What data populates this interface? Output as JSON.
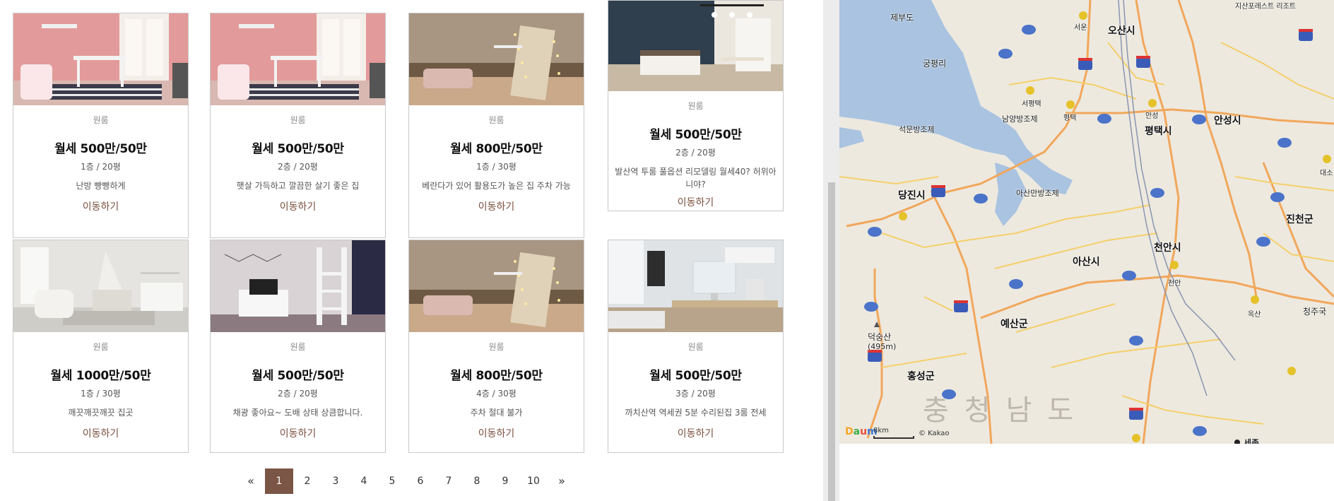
{
  "listings": [
    {
      "type": "원룸",
      "price": "월세 500만/50만",
      "floor": "1층 / 20평",
      "desc": "난방 빵빵하게",
      "link": "이동하기",
      "photo": "pink-room"
    },
    {
      "type": "원룸",
      "price": "월세 500만/50만",
      "floor": "2층 / 20평",
      "desc": "햇살 가득하고 깔끔한 살기 좋은 집",
      "link": "이동하기",
      "photo": "pink-room"
    },
    {
      "type": "원룸",
      "price": "월세 800만/50만",
      "floor": "1층 / 30평",
      "desc": "베란다가 있어 활용도가 높은 집 주차 가능",
      "link": "이동하기",
      "photo": "mirror-room"
    },
    {
      "type": "원룸",
      "price": "월세 500만/50만",
      "floor": "2층 / 20평",
      "desc": "발산역 투룸 풀옵션 리모델링 월세40? 허위아니야?",
      "link": "이동하기",
      "photo": "navy-room"
    },
    {
      "type": "원룸",
      "price": "월세 1000만/50만",
      "floor": "1층 / 30평",
      "desc": "깨끗깨끗깨끗 집곳",
      "link": "이동하기",
      "photo": "nursery"
    },
    {
      "type": "원룸",
      "price": "월세 500만/50만",
      "floor": "2층 / 20평",
      "desc": "채광 좋아요~ 도배 상태 상큼합니다.",
      "link": "이동하기",
      "photo": "loft-room"
    },
    {
      "type": "원룸",
      "price": "월세 800만/50만",
      "floor": "4층 / 30평",
      "desc": "주차 절대 불가",
      "link": "이동하기",
      "photo": "mirror-room"
    },
    {
      "type": "원룸",
      "price": "월세 500만/50만",
      "floor": "3층 / 20평",
      "desc": "까치산역 역세권 5분 수리된집 3룸 전세",
      "link": "이동하기",
      "photo": "desk-room"
    }
  ],
  "pagination": {
    "prev": "«",
    "next": "»",
    "pages": [
      "1",
      "2",
      "3",
      "4",
      "5",
      "6",
      "7",
      "8",
      "9",
      "10"
    ],
    "current": "1"
  },
  "map": {
    "labels": {
      "osan": "오산시",
      "anseong": "안성시",
      "pyeongtaek": "평택시",
      "dangjin": "당진시",
      "asan": "아산시",
      "cheonan": "천안시",
      "jincheon": "진천군",
      "yesan": "예산군",
      "hongseong": "홍성군",
      "chungnam": "충청남도",
      "sejong": "세종",
      "jebu": "제부도",
      "gungpyeong": "궁평리",
      "seokmun": "석문방조제",
      "namyang": "남양방조제",
      "asanman": "아산만방조제",
      "deoksungsan": "덕숭산",
      "deoksungsan_h": "(495m)",
      "seoun": "서운",
      "seopyeongtaek": "서평택",
      "pyeongtaek_jc": "평택",
      "anseong_ic": "안성",
      "cheonan_ic": "천안",
      "oksan": "옥산",
      "cheongju": "청주국",
      "daeso": "대소",
      "resort": "지산포레스트 리조트"
    },
    "logo": {
      "d": "D",
      "a": "a",
      "u": "u",
      "m": "m"
    },
    "scale": "8km",
    "copyright": "© Kakao",
    "colors": {
      "water": "#a9c3e0",
      "land": "#ede9df",
      "road_major": "#f1a75b",
      "road_minor": "#f5cf6a"
    }
  }
}
